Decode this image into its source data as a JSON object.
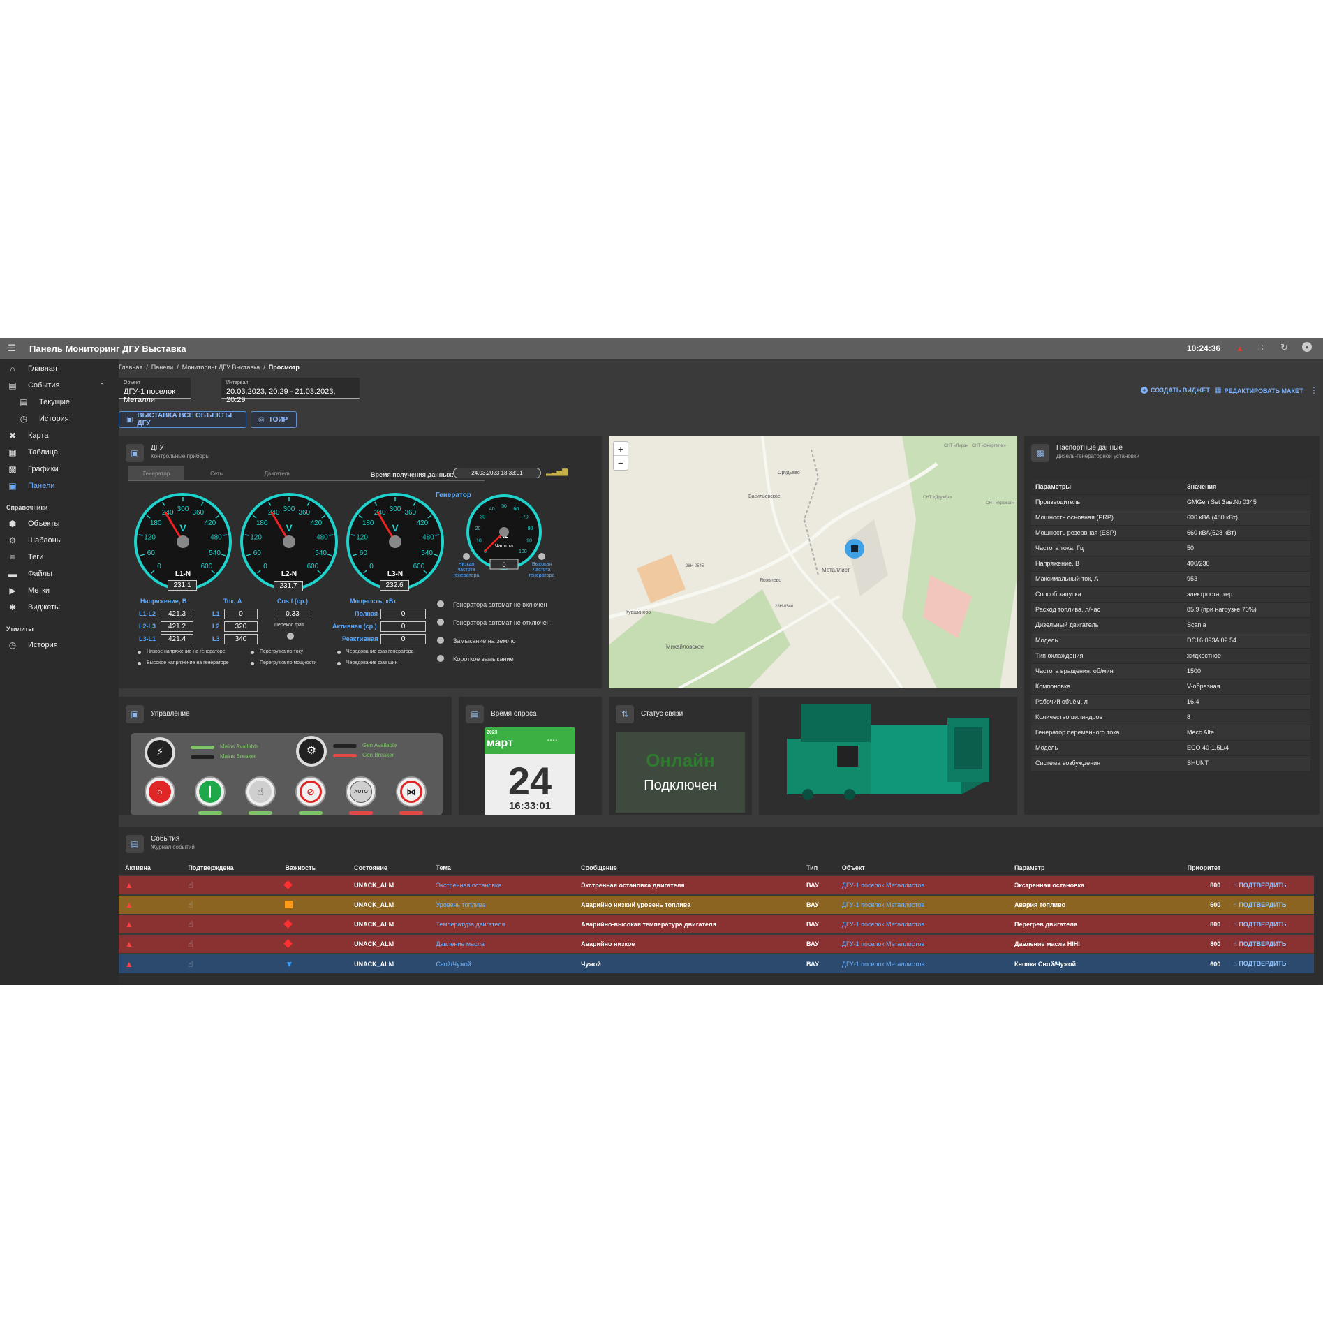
{
  "app": {
    "title": "Панель Мониторинг ДГУ Выставка",
    "clock": "10:24:36"
  },
  "sidebar": {
    "items": [
      {
        "label": "Главная",
        "icon": "home-icon"
      },
      {
        "label": "События",
        "icon": "calendar-icon"
      },
      {
        "label": "Текущие",
        "icon": "calendar-icon"
      },
      {
        "label": "История",
        "icon": "history-icon"
      },
      {
        "label": "Карта",
        "icon": "map-icon"
      },
      {
        "label": "Таблица",
        "icon": "table-icon"
      },
      {
        "label": "Графики",
        "icon": "chart-icon"
      },
      {
        "label": "Панели",
        "icon": "dashboard-icon"
      }
    ],
    "section_refs": "Справочники",
    "refs": [
      {
        "label": "Объекты",
        "icon": "cube-icon"
      },
      {
        "label": "Шаблоны",
        "icon": "template-icon"
      },
      {
        "label": "Теги",
        "icon": "layers-icon"
      },
      {
        "label": "Файлы",
        "icon": "folder-icon"
      },
      {
        "label": "Метки",
        "icon": "label-icon"
      },
      {
        "label": "Виджеты",
        "icon": "puzzle-icon"
      }
    ],
    "section_utils": "Утилиты",
    "utils": [
      {
        "label": "История",
        "icon": "history-icon"
      }
    ]
  },
  "breadcrumb": {
    "c1": "Главная",
    "c2": "Панели",
    "c3": "Мониторинг ДГУ Выставка",
    "c4": "Просмотр",
    "sep": "/"
  },
  "filters": {
    "object_label": "Объект",
    "object_value": "ДГУ-1 поселок Металли",
    "interval_label": "Интервал",
    "interval_value": "20.03.2023, 20:29 - 21.03.2023, 20:29"
  },
  "actions": {
    "create_widget": "СОЗДАТЬ ВИДЖЕТ",
    "edit_layout": "РЕДАКТИРОВАТЬ МАКЕТ"
  },
  "buttons": {
    "all_objects": "ВЫСТАВКА ВСЕ ОБЪЕКТЫ ДГУ",
    "toir": "ТОИР"
  },
  "dgu": {
    "title": "ДГУ",
    "subtitle": "Контрольные приборы",
    "tabs": [
      "Генератор",
      "Сеть",
      "Двигатель"
    ],
    "time_label": "Время получения данных:",
    "time_value": "24.03.2023 18:33:01",
    "generator_label": "Генератор",
    "gauges": [
      {
        "name": "L1-N",
        "value": "231.1",
        "unit": "V",
        "level": 231.1
      },
      {
        "name": "L2-N",
        "value": "231.7",
        "unit": "V",
        "level": 231.7
      },
      {
        "name": "L3-N",
        "value": "232.6",
        "unit": "V",
        "level": 232.6
      }
    ],
    "gauge_ticks": [
      "0",
      "60",
      "120",
      "180",
      "240",
      "300",
      "360",
      "420",
      "480",
      "540",
      "600"
    ],
    "freq": {
      "unit": "Hz",
      "label": "Частота",
      "value": "0",
      "ticks": [
        "0",
        "10",
        "20",
        "30",
        "40",
        "50",
        "60",
        "70",
        "80",
        "90",
        "100"
      ],
      "low": "Низкая частота генератора",
      "high": "Высокая частота генератора"
    },
    "voltage_title": "Напряжение, В",
    "current_title": "Ток, А",
    "cos_title": "Cos f (ср.)",
    "power_title": "Мощность, кВт",
    "voltages": [
      {
        "l": "L1-L2",
        "v": "421.3"
      },
      {
        "l": "L2-L3",
        "v": "421.2"
      },
      {
        "l": "L3-L1",
        "v": "421.4"
      }
    ],
    "currents": [
      {
        "l": "L1",
        "v": "0"
      },
      {
        "l": "L2",
        "v": "320"
      },
      {
        "l": "L3",
        "v": "340"
      }
    ],
    "cos_value": "0.33",
    "phase_skew": "Перекос фаз",
    "powers": [
      {
        "l": "Полная",
        "v": "0"
      },
      {
        "l": "Активная (ср.)",
        "v": "0"
      },
      {
        "l": "Реактивная",
        "v": "0"
      }
    ],
    "alarms": [
      "Генератора автомат не включен",
      "Генератора автомат не отключен",
      "Замыкание на землю",
      "Короткое замыкание"
    ],
    "notes": [
      "Низкое напряжение на генераторе",
      "Высокое напряжение на генераторе",
      "Перегрузка по току",
      "Перегрузка по мощности",
      "Чередование фаз генератора",
      "Чередование фаз шин"
    ]
  },
  "map": {
    "zoom_in": "+",
    "zoom_out": "−",
    "places": [
      "Орудьево",
      "Васильевское",
      "Металлист",
      "Яковлево",
      "Кувшиново",
      "Михайловское",
      "СНТ «Лира»",
      "СНТ «Энергетик»",
      "СНТ «Урожай»",
      "СНТ «Дружба»",
      "28Н-0545",
      "28Н-0546"
    ]
  },
  "passport": {
    "title": "Паспортные данные",
    "subtitle": "Дизель-генераторной установки",
    "col1": "Параметры",
    "col2": "Значения",
    "rows": [
      [
        "Производитель",
        "GMGen Set Зав.№ 0345"
      ],
      [
        "Мощность основная (PRP)",
        "600 кВА (480 кВт)"
      ],
      [
        "Мощность резервная (ESP)",
        "660 кВА(528 кВт)"
      ],
      [
        "Частота тока, Гц",
        "50"
      ],
      [
        "Напряжение, В",
        "400/230"
      ],
      [
        "Максимальный ток, А",
        "953"
      ],
      [
        "Способ запуска",
        "электростартер"
      ],
      [
        "Расход топлива, л/час",
        "85.9 (при нагрузке 70%)"
      ],
      [
        "Дизельный двигатель",
        "Scania"
      ],
      [
        "Модель",
        "DC16 093A 02 54"
      ],
      [
        "Тип охлаждения",
        "жидкостное"
      ],
      [
        "Частота вращения, об/мин",
        "1500"
      ],
      [
        "Компоновка",
        "V-образная"
      ],
      [
        "Рабочий объём, л",
        "16.4"
      ],
      [
        "Количество цилиндров",
        "8"
      ],
      [
        "Генератор переменного тока",
        "Mecc Alte"
      ],
      [
        "Модель",
        "ECO 40-1.5L/4"
      ],
      [
        "Система возбуждения",
        "SHUNT"
      ]
    ]
  },
  "control": {
    "title": "Управление",
    "mains_available": "Mains Available",
    "mains_breaker": "Mains Breaker",
    "gen_available": "Gen Available",
    "gen_breaker": "Gen Breaker",
    "auto": "AUTO"
  },
  "poll": {
    "title": "Время опроса",
    "year": "2023",
    "month": "март",
    "day": "24",
    "time": "16:33:01"
  },
  "link": {
    "title": "Статус связи",
    "online": "Онлайн",
    "connected": "Подключен"
  },
  "events": {
    "title": "События",
    "subtitle": "Журнал событий",
    "headers": [
      "Активна",
      "Подтверждена",
      "Важность",
      "Состояние",
      "Тема",
      "Сообщение",
      "Тип",
      "Объект",
      "Параметр",
      "Приоритет",
      ""
    ],
    "confirm": "ПОДТВЕРДИТЬ",
    "rows": [
      {
        "state": "UNACK_ALM",
        "topic": "Экстренная остановка",
        "msg": "Экстренная остановка двигателя",
        "type": "ВАУ",
        "obj": "ДГУ-1 поселок Металлистов",
        "param": "Экстренная остановка",
        "prio": "800",
        "bg": "#8a3232",
        "sev": "diamond"
      },
      {
        "state": "UNACK_ALM",
        "topic": "Уровень топлива",
        "msg": "Аварийно низкий уровень топлива",
        "type": "ВАУ",
        "obj": "ДГУ-1 поселок Металлистов",
        "param": "Авария топливо",
        "prio": "600",
        "bg": "#8a6420",
        "sev": "square"
      },
      {
        "state": "UNACK_ALM",
        "topic": "Температура двигателя",
        "msg": "Аварийно-высокая температура двигателя",
        "type": "ВАУ",
        "obj": "ДГУ-1 поселок Металлистов",
        "param": "Перегрев двигателя",
        "prio": "800",
        "bg": "#8a3232",
        "sev": "diamond"
      },
      {
        "state": "UNACK_ALM",
        "topic": "Давление масла",
        "msg": "Аварийно низкое",
        "type": "ВАУ",
        "obj": "ДГУ-1 поселок Металлистов",
        "param": "Давление масла HIHI",
        "prio": "800",
        "bg": "#8a3232",
        "sev": "diamond"
      },
      {
        "state": "UNACK_ALM",
        "topic": "Свой/Чужой",
        "msg": "Чужой",
        "type": "ВАУ",
        "obj": "ДГУ-1 поселок Металлистов",
        "param": "Кнопка Свой/Чужой",
        "prio": "600",
        "bg": "#2b4a6e",
        "sev": "triangle"
      }
    ]
  },
  "colors": {
    "accent": "#64a8ff",
    "gauge_ring": "#1fd3cc",
    "online": "#2f7a2f",
    "calendar_green": "#3cb043"
  }
}
